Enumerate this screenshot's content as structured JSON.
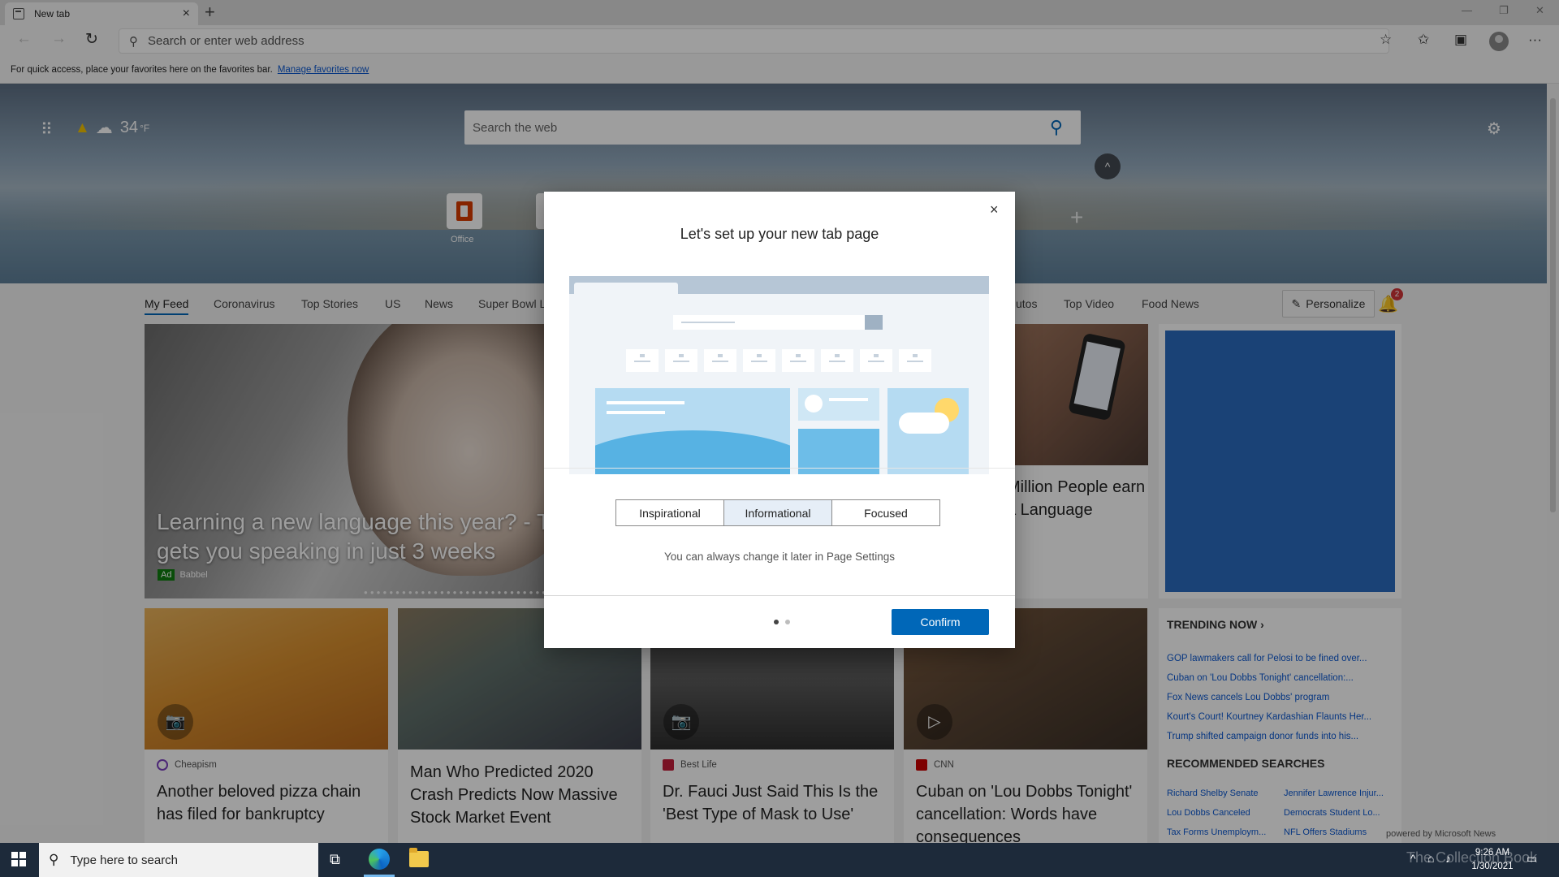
{
  "browser": {
    "tab_title": "New tab",
    "tab_close": "×",
    "new_tab": "+",
    "address_placeholder": "Search or enter web address",
    "favbar_text": "For quick access, place your favorites here on the favorites bar.",
    "favbar_link": "Manage favorites now"
  },
  "page": {
    "weather_temp": "34",
    "weather_unit": "°F",
    "search_placeholder": "Search the web",
    "top_sites": [
      {
        "label": "Office"
      }
    ],
    "feed_tabs": [
      "My Feed",
      "Coronavirus",
      "Top Stories",
      "US",
      "News",
      "Super Bowl L",
      "utos",
      "Top Video",
      "Food News"
    ],
    "personalize_label": "Personalize",
    "notification_count": "2"
  },
  "feed": {
    "hero_headline": "Learning a new language this year? - T gets you speaking in just 3 weeks",
    "hero_ad_label": "Ad",
    "hero_source": "Babbel",
    "side_headline": "Million People earn a Language",
    "cards": [
      {
        "source": "Cheapism",
        "headline": "Another beloved pizza chain has filed for bankruptcy"
      },
      {
        "source": "",
        "headline": "Man Who Predicted 2020 Crash Predicts Now Massive Stock Market Event"
      },
      {
        "source": "Best Life",
        "headline": "Dr. Fauci Just Said This Is the 'Best Type of Mask to Use'"
      },
      {
        "source": "CNN",
        "headline": "Cuban on 'Lou Dobbs Tonight' cancellation: Words have consequences"
      }
    ],
    "trending_title": "TRENDING NOW",
    "trending": [
      "GOP lawmakers call for Pelosi to be fined over...",
      "Cuban on 'Lou Dobbs Tonight' cancellation:...",
      "Fox News cancels Lou Dobbs' program",
      "Kourt's Court! Kourtney Kardashian Flaunts Her...",
      "Trump shifted campaign donor funds into his..."
    ],
    "recommended_title": "RECOMMENDED SEARCHES",
    "recommended": [
      "Richard Shelby Senate",
      "Jennifer Lawrence Injur...",
      "Lou Dobbs Canceled",
      "Democrats Student Lo...",
      "Tax Forms Unemploym...",
      "NFL Offers Stadiums"
    ],
    "powered_by": "powered by Microsoft News"
  },
  "dialog": {
    "title": "Let's set up your new tab page",
    "close": "×",
    "options": [
      "Inspirational",
      "Informational",
      "Focused"
    ],
    "selected_option": "Informational",
    "note": "You can always change it later in Page Settings",
    "confirm_label": "Confirm",
    "page_index": 1,
    "page_count": 2
  },
  "taskbar": {
    "search_placeholder": "Type here to search",
    "time": "9:26 AM",
    "date": "1/30/2021",
    "watermark": "The Collection Book"
  },
  "icons": {
    "apps": "⠿",
    "warning": "▲",
    "cloud": "☁",
    "search": "🔍",
    "gear": "⚙",
    "chevron_up": "^",
    "add": "+",
    "bell": "🔔",
    "pencil": "✎",
    "camera": "📷",
    "play": "▷"
  }
}
